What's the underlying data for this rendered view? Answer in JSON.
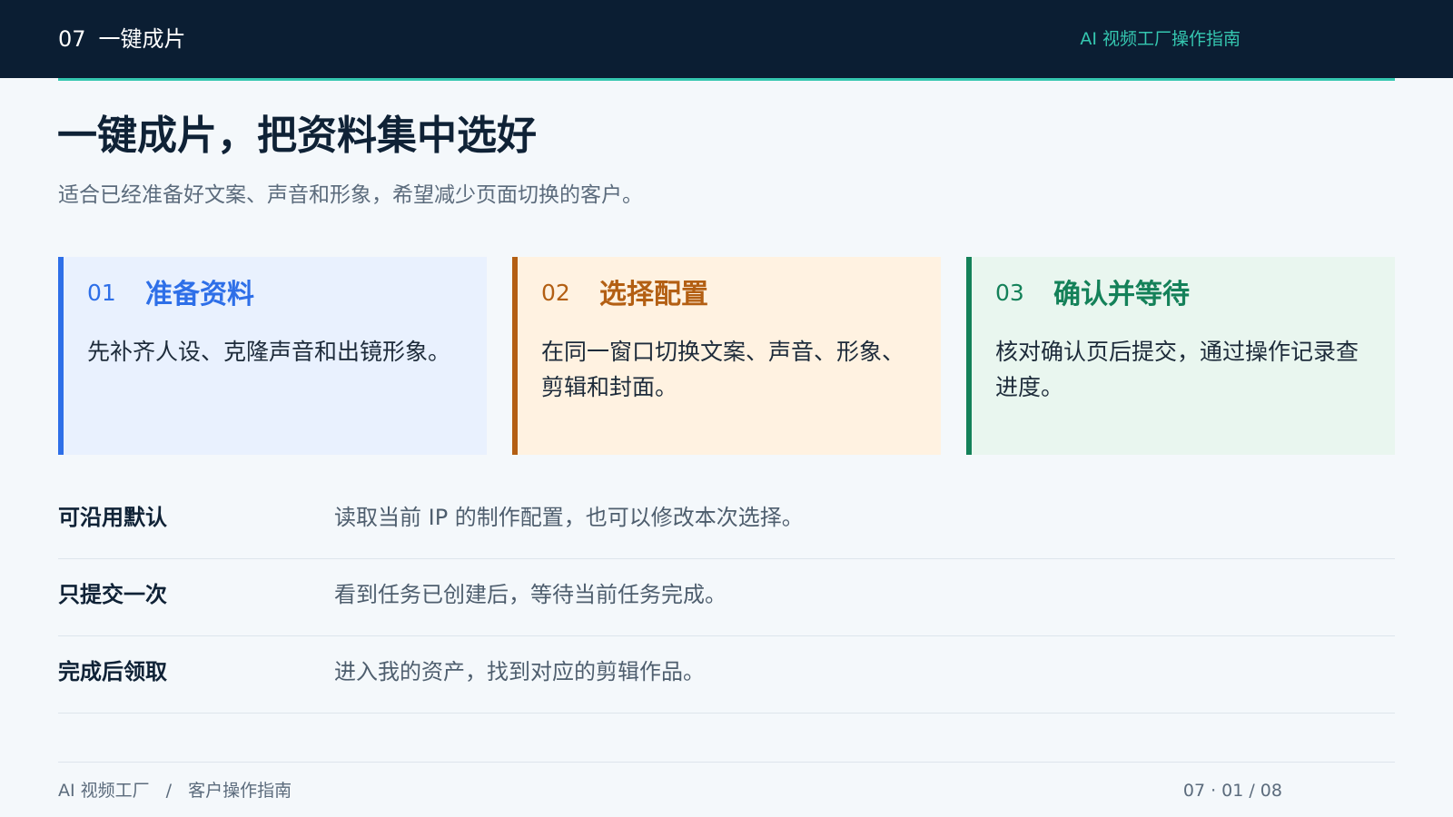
{
  "header": {
    "section_number": "07",
    "section_title": "一键成片",
    "brand": "AI 视频工厂操作指南"
  },
  "main": {
    "title": "一键成片，把资料集中选好",
    "subtitle": "适合已经准备好文案、声音和形象，希望减少页面切换的客户。",
    "steps": [
      {
        "number": "01",
        "title": "准备资料",
        "description": "先补齐人设、克隆声音和出镜形象。"
      },
      {
        "number": "02",
        "title": "选择配置",
        "description": "在同一窗口切换文案、声音、形象、剪辑和封面。"
      },
      {
        "number": "03",
        "title": "确认并等待",
        "description": "核对确认页后提交，通过操作记录查进度。"
      }
    ],
    "notes": [
      {
        "label": "可沿用默认",
        "text": "读取当前 IP 的制作配置，也可以修改本次选择。"
      },
      {
        "label": "只提交一次",
        "text": "看到任务已创建后，等待当前任务完成。"
      },
      {
        "label": "完成后领取",
        "text": "进入我的资产，找到对应的剪辑作品。"
      }
    ]
  },
  "footer": {
    "brand": "AI 视频工厂",
    "separator": "/",
    "guide": "客户操作指南",
    "page_indicator": "07 · 01 / 08"
  },
  "colors": {
    "header_bg": "#0b1e33",
    "accent": "#35c7b0",
    "step1": "#2e6fe8",
    "step2": "#b35f13",
    "step3": "#148159"
  }
}
